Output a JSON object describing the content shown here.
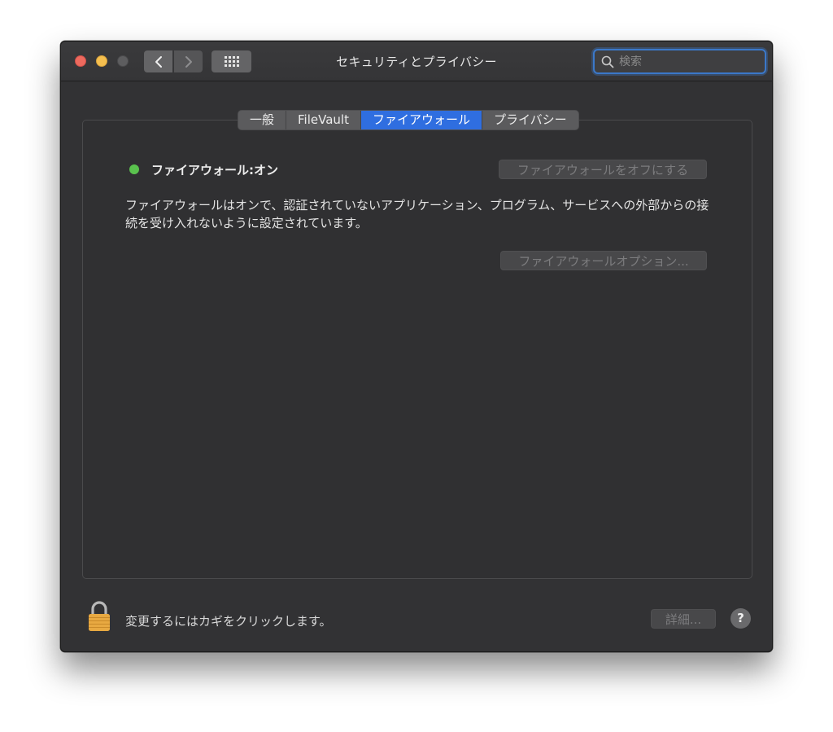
{
  "window": {
    "title": "セキュリティとプライバシー",
    "search_placeholder": "検索"
  },
  "tabs": [
    {
      "label": "一般",
      "active": false
    },
    {
      "label": "FileVault",
      "active": false
    },
    {
      "label": "ファイアウォール",
      "active": true
    },
    {
      "label": "プライバシー",
      "active": false
    }
  ],
  "firewall": {
    "status_label": "ファイアウォール:オン",
    "status_color": "#5ac24e",
    "turn_off_button": "ファイアウォールをオフにする",
    "description": "ファイアウォールはオンで、認証されていないアプリケーション、プログラム、サービスへの外部からの接続を受け入れないように設定されています。",
    "options_button": "ファイアウォールオプション..."
  },
  "footer": {
    "lock_text": "変更するにはカギをクリックします。",
    "details_button": "詳細...",
    "help_label": "?"
  },
  "colors": {
    "accent": "#2f6ee0",
    "window_bg": "#323234"
  },
  "icons": {
    "back": "chevron-left-icon",
    "forward": "chevron-right-icon",
    "grid": "grid-icon",
    "search": "search-icon",
    "lock": "lock-icon"
  }
}
